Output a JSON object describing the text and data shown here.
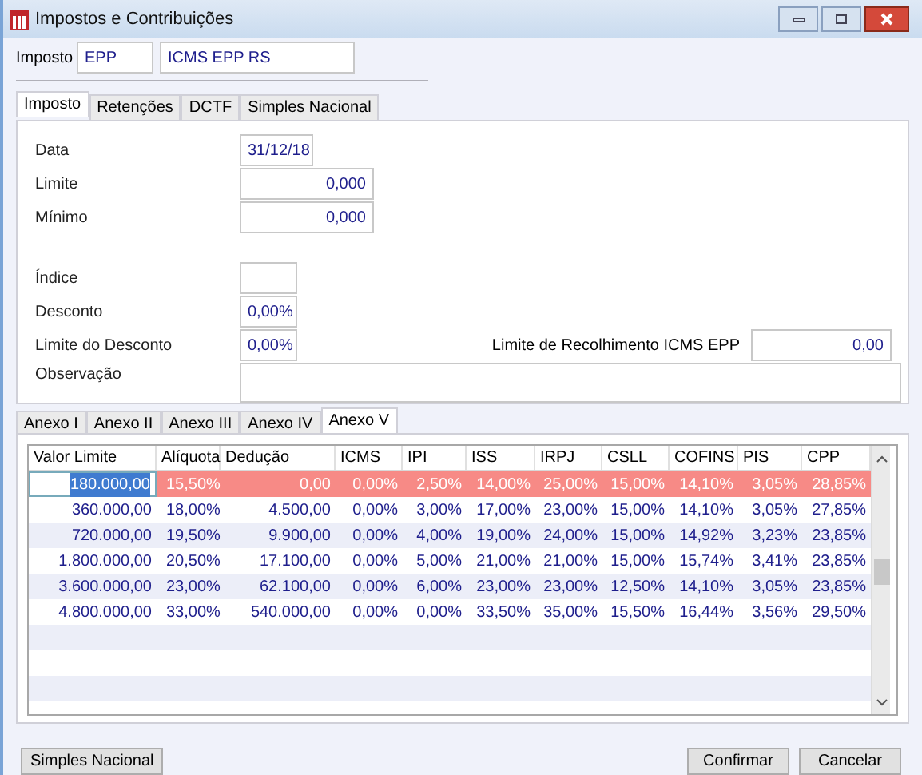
{
  "window": {
    "title": "Impostos e Contribuições"
  },
  "imposto": {
    "label": "Imposto",
    "code": "EPP",
    "name": "ICMS EPP RS"
  },
  "tabs": [
    {
      "label": "Imposto",
      "selected": true
    },
    {
      "label": "Retenções",
      "selected": false
    },
    {
      "label": "DCTF",
      "selected": false
    },
    {
      "label": "Simples Nacional",
      "selected": false
    }
  ],
  "fields": {
    "data": {
      "label": "Data",
      "value": "31/12/18"
    },
    "limite": {
      "label": "Limite",
      "value": "0,000"
    },
    "minimo": {
      "label": "Mínimo",
      "value": "0,000"
    },
    "indice": {
      "label": "Índice"
    },
    "desconto": {
      "label": "Desconto",
      "value": "0,00%"
    },
    "limite_desconto": {
      "label": "Limite do Desconto",
      "value": "0,00%"
    },
    "limite_recolhimento": {
      "label": "Limite de Recolhimento ICMS EPP",
      "value": "0,00"
    },
    "observacao": {
      "label": "Observação"
    }
  },
  "annex_tabs": [
    {
      "label": "Anexo I",
      "selected": false
    },
    {
      "label": "Anexo II",
      "selected": false
    },
    {
      "label": "Anexo III",
      "selected": false
    },
    {
      "label": "Anexo IV",
      "selected": false
    },
    {
      "label": "Anexo V",
      "selected": true
    }
  ],
  "table": {
    "columns": [
      "Valor Limite",
      "Alíquota",
      "Dedução",
      "ICMS",
      "IPI",
      "ISS",
      "IRPJ",
      "CSLL",
      "COFINS",
      "PIS",
      "CPP"
    ],
    "rows": [
      {
        "selected": true,
        "cells": [
          "180.000,00",
          "15,50%",
          "0,00",
          "0,00%",
          "2,50%",
          "14,00%",
          "25,00%",
          "15,00%",
          "14,10%",
          "3,05%",
          "28,85%"
        ]
      },
      {
        "selected": false,
        "cells": [
          "360.000,00",
          "18,00%",
          "4.500,00",
          "0,00%",
          "3,00%",
          "17,00%",
          "23,00%",
          "15,00%",
          "14,10%",
          "3,05%",
          "27,85%"
        ]
      },
      {
        "selected": false,
        "cells": [
          "720.000,00",
          "19,50%",
          "9.900,00",
          "0,00%",
          "4,00%",
          "19,00%",
          "24,00%",
          "15,00%",
          "14,92%",
          "3,23%",
          "23,85%"
        ]
      },
      {
        "selected": false,
        "cells": [
          "1.800.000,00",
          "20,50%",
          "17.100,00",
          "0,00%",
          "5,00%",
          "21,00%",
          "21,00%",
          "15,00%",
          "15,74%",
          "3,41%",
          "23,85%"
        ]
      },
      {
        "selected": false,
        "cells": [
          "3.600.000,00",
          "23,00%",
          "62.100,00",
          "0,00%",
          "6,00%",
          "23,00%",
          "23,00%",
          "12,50%",
          "14,10%",
          "3,05%",
          "23,85%"
        ]
      },
      {
        "selected": false,
        "cells": [
          "4.800.000,00",
          "33,00%",
          "540.000,00",
          "0,00%",
          "0,00%",
          "33,50%",
          "35,00%",
          "15,50%",
          "16,44%",
          "3,56%",
          "29,50%"
        ]
      }
    ]
  },
  "buttons": {
    "left": "Simples Nacional",
    "confirm": "Confirmar",
    "cancel": "Cancelar"
  }
}
